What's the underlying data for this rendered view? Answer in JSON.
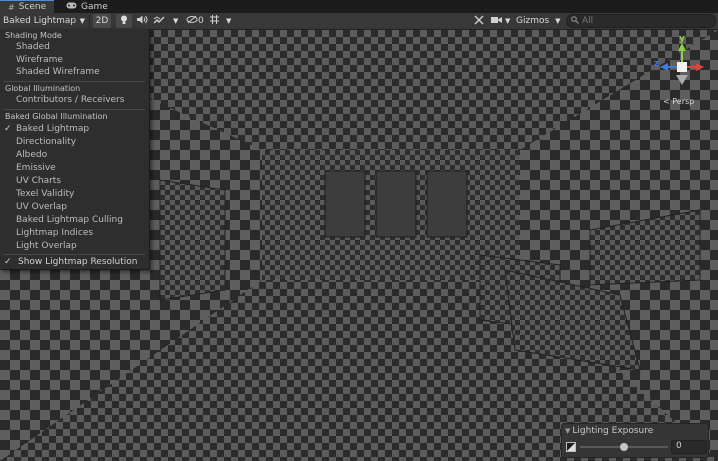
{
  "tabs": [
    {
      "label": "Scene",
      "icon": "hash-icon",
      "active": true
    },
    {
      "label": "Game",
      "icon": "game-controller-icon",
      "active": false
    }
  ],
  "toolbar": {
    "draw_mode": "Baked Lightmap",
    "mode_2d": "2D",
    "hidden_count": "0",
    "gizmos": "Gizmos",
    "search_placeholder": "All"
  },
  "menu": {
    "sections": [
      {
        "header": "Shading Mode",
        "items": [
          {
            "label": "Shaded",
            "checked": false
          },
          {
            "label": "Wireframe",
            "checked": false
          },
          {
            "label": "Shaded Wireframe",
            "checked": false
          }
        ]
      },
      {
        "header": "Global Illumination",
        "items": [
          {
            "label": "Contributors / Receivers",
            "checked": false
          }
        ]
      },
      {
        "header": "Baked Global Illumination",
        "items": [
          {
            "label": "Baked Lightmap",
            "checked": true
          },
          {
            "label": "Directionality",
            "checked": false
          },
          {
            "label": "Albedo",
            "checked": false
          },
          {
            "label": "Emissive",
            "checked": false
          },
          {
            "label": "UV Charts",
            "checked": false
          },
          {
            "label": "Texel Validity",
            "checked": false
          },
          {
            "label": "UV Overlap",
            "checked": false
          },
          {
            "label": "Baked Lightmap Culling",
            "checked": false
          },
          {
            "label": "Lightmap Indices",
            "checked": false
          },
          {
            "label": "Light Overlap",
            "checked": false
          }
        ]
      }
    ],
    "check_mark": "✓",
    "show_resolution": {
      "label": "Show Lightmap Resolution",
      "checked": true
    }
  },
  "gizmo": {
    "x": "x",
    "y": "y",
    "z": "z",
    "projection": "< Persp"
  },
  "lighting_exposure": {
    "title": "Lighting Exposure",
    "value": "0",
    "slider_fraction": 0.5
  },
  "colors": {
    "accent": "#4a90d9",
    "panel": "#2e2e2e",
    "checker_dark": "#2d2d2d",
    "checker_light": "#5a5a5a",
    "gizmo_x": "#d8463a",
    "gizmo_y": "#8ed046",
    "gizmo_z": "#3a7ce0"
  }
}
